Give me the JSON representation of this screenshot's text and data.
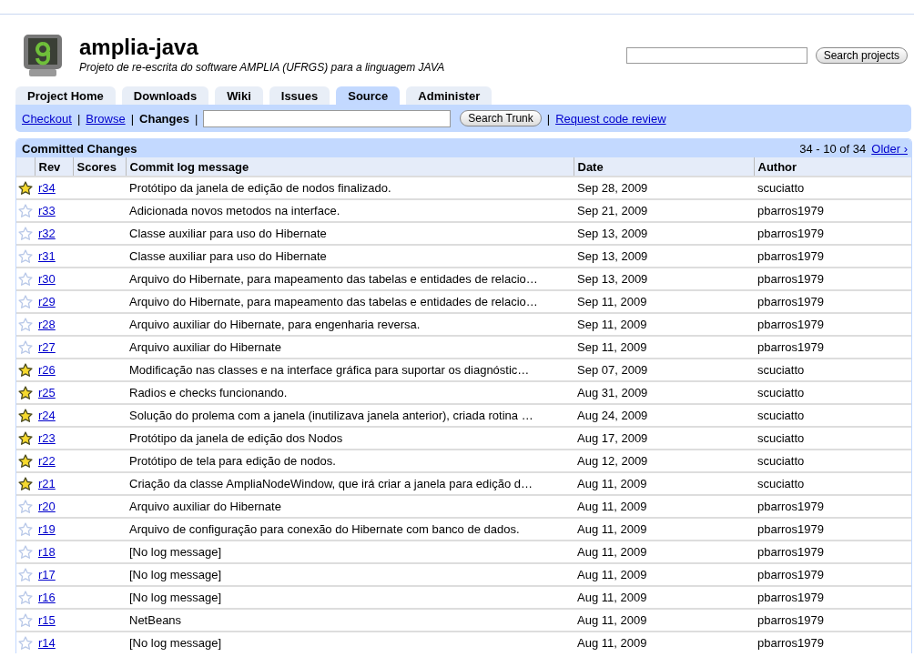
{
  "project": {
    "name": "amplia-java",
    "summary": "Projeto de re-escrita do software AMPLIA (UFRGS) para a linguagem JAVA"
  },
  "search": {
    "button": "Search projects"
  },
  "tabs": [
    {
      "label": "Project Home",
      "selected": false
    },
    {
      "label": "Downloads",
      "selected": false
    },
    {
      "label": "Wiki",
      "selected": false
    },
    {
      "label": "Issues",
      "selected": false
    },
    {
      "label": "Source",
      "selected": true
    },
    {
      "label": "Administer",
      "selected": false
    }
  ],
  "subnav": {
    "items": [
      {
        "kind": "link",
        "label": "Checkout",
        "selected": false
      },
      {
        "kind": "separator",
        "label": "|"
      },
      {
        "kind": "link",
        "label": "Browse",
        "selected": false
      },
      {
        "kind": "separator",
        "label": "|"
      },
      {
        "kind": "link",
        "label": "Changes",
        "selected": true
      },
      {
        "kind": "separator",
        "label": "|"
      },
      {
        "kind": "field"
      },
      {
        "kind": "button",
        "label": "Search Trunk"
      },
      {
        "kind": "separator",
        "label": "|"
      },
      {
        "kind": "link",
        "label": "Request code review",
        "selected": false
      }
    ]
  },
  "table": {
    "title": "Committed Changes",
    "pagination": "34 - 10 of 34",
    "older_link": "Older ›",
    "columns": [
      "Rev",
      "Scores",
      "Commit log message",
      "Date",
      "Author"
    ],
    "rows": [
      {
        "starred": true,
        "rev": "r34",
        "message": "Protótipo da janela de edição de nodos finalizado.",
        "date": "Sep 28, 2009",
        "author": "scuciatto"
      },
      {
        "starred": false,
        "rev": "r33",
        "message": "Adicionada novos metodos na interface.",
        "date": "Sep 21, 2009",
        "author": "pbarros1979"
      },
      {
        "starred": false,
        "rev": "r32",
        "message": "Classe auxiliar para uso do Hibernate",
        "date": "Sep 13, 2009",
        "author": "pbarros1979"
      },
      {
        "starred": false,
        "rev": "r31",
        "message": "Classe auxiliar para uso do Hibernate",
        "date": "Sep 13, 2009",
        "author": "pbarros1979"
      },
      {
        "starred": false,
        "rev": "r30",
        "message": "Arquivo do Hibernate, para mapeamento das tabelas e entidades de relacio…",
        "date": "Sep 13, 2009",
        "author": "pbarros1979"
      },
      {
        "starred": false,
        "rev": "r29",
        "message": "Arquivo do Hibernate, para mapeamento das tabelas e entidades de relacio…",
        "date": "Sep 11, 2009",
        "author": "pbarros1979"
      },
      {
        "starred": false,
        "rev": "r28",
        "message": "Arquivo auxiliar do Hibernate, para engenharia reversa.",
        "date": "Sep 11, 2009",
        "author": "pbarros1979"
      },
      {
        "starred": false,
        "rev": "r27",
        "message": "Arquivo auxiliar do Hibernate",
        "date": "Sep 11, 2009",
        "author": "pbarros1979"
      },
      {
        "starred": true,
        "rev": "r26",
        "message": "Modificação nas classes e na interface gráfica para suportar os diagnóstic…",
        "date": "Sep 07, 2009",
        "author": "scuciatto"
      },
      {
        "starred": true,
        "rev": "r25",
        "message": "Radios e checks funcionando.",
        "date": "Aug 31, 2009",
        "author": "scuciatto"
      },
      {
        "starred": true,
        "rev": "r24",
        "message": "Solução do prolema com a janela (inutilizava janela anterior), criada rotina …",
        "date": "Aug 24, 2009",
        "author": "scuciatto"
      },
      {
        "starred": true,
        "rev": "r23",
        "message": "Protótipo da janela de edição dos Nodos",
        "date": "Aug 17, 2009",
        "author": "scuciatto"
      },
      {
        "starred": true,
        "rev": "r22",
        "message": "Protótipo de tela para edição de nodos.",
        "date": "Aug 12, 2009",
        "author": "scuciatto"
      },
      {
        "starred": true,
        "rev": "r21",
        "message": "Criação da classe AmpliaNodeWindow, que irá criar a janela para edição d…",
        "date": "Aug 11, 2009",
        "author": "scuciatto"
      },
      {
        "starred": false,
        "rev": "r20",
        "message": "Arquivo auxiliar do Hibernate",
        "date": "Aug 11, 2009",
        "author": "pbarros1979"
      },
      {
        "starred": false,
        "rev": "r19",
        "message": "Arquivo de configuração para conexão do Hibernate com banco de dados.",
        "date": "Aug 11, 2009",
        "author": "pbarros1979"
      },
      {
        "starred": false,
        "rev": "r18",
        "message": "[No log message]",
        "date": "Aug 11, 2009",
        "author": "pbarros1979"
      },
      {
        "starred": false,
        "rev": "r17",
        "message": "[No log message]",
        "date": "Aug 11, 2009",
        "author": "pbarros1979"
      },
      {
        "starred": false,
        "rev": "r16",
        "message": "[No log message]",
        "date": "Aug 11, 2009",
        "author": "pbarros1979"
      },
      {
        "starred": false,
        "rev": "r15",
        "message": "NetBeans",
        "date": "Aug 11, 2009",
        "author": "pbarros1979"
      },
      {
        "starred": false,
        "rev": "r14",
        "message": "[No log message]",
        "date": "Aug 11, 2009",
        "author": "pbarros1979"
      }
    ]
  }
}
